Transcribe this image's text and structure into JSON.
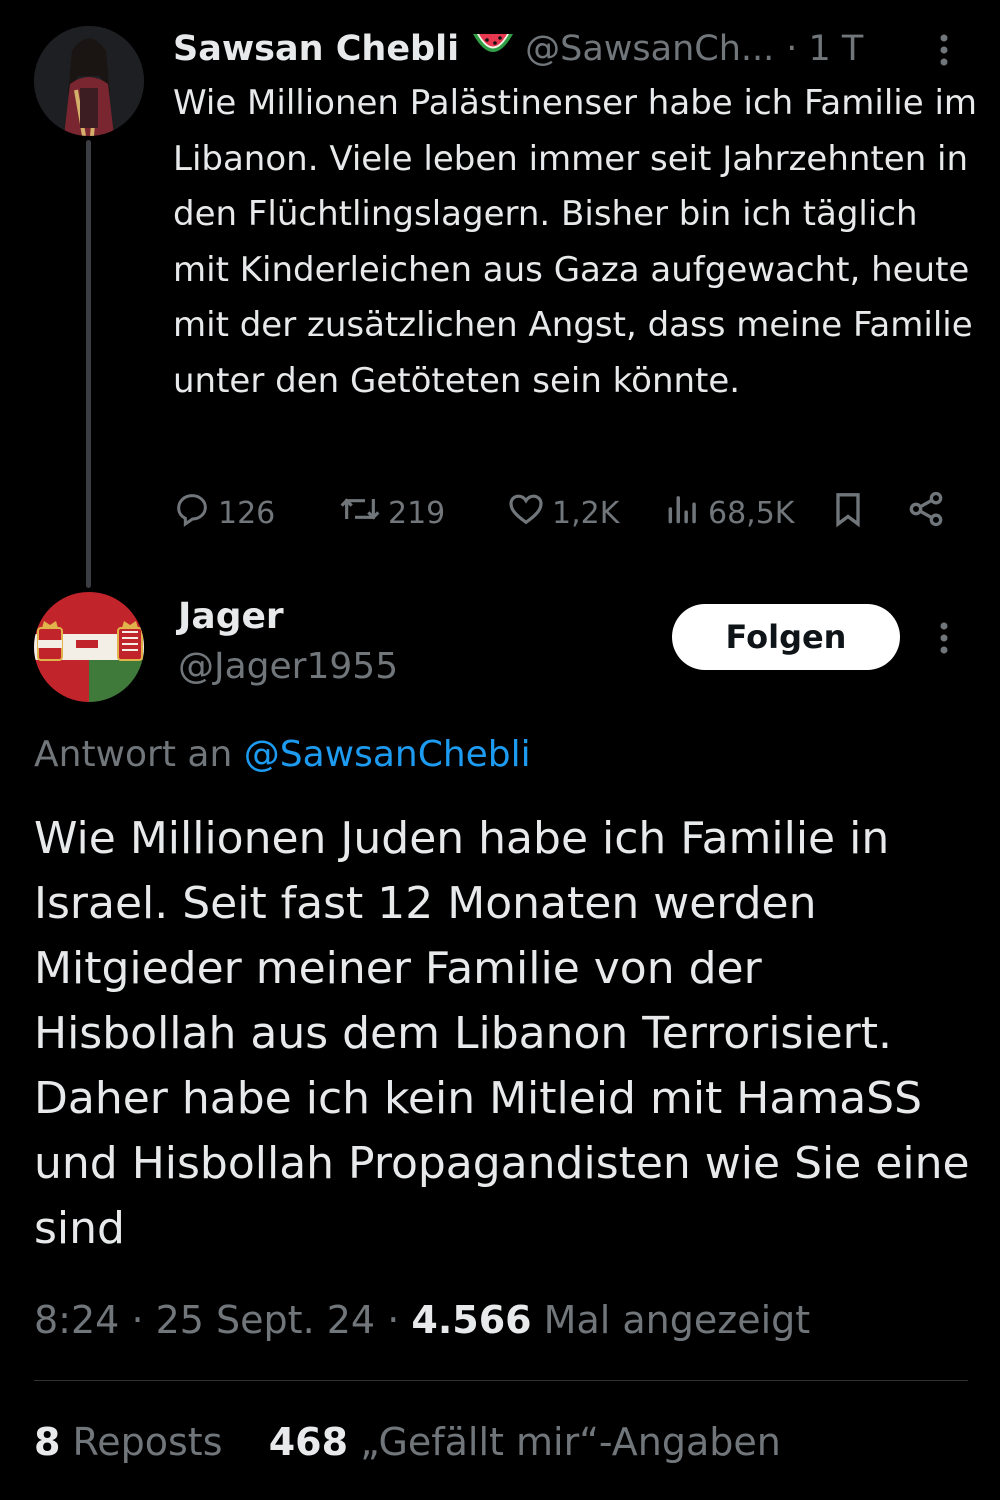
{
  "parent_tweet": {
    "author_name": "Sawsan Chebli",
    "author_handle": "@SawsanCh...",
    "time_ago": "· 1 T",
    "badge_icon": "watermelon-icon",
    "text": "Wie Millionen Palästinenser habe ich Familie im Libanon. Viele leben immer seit Jahrzehnten in den Flüchtlingslagern. Bisher bin ich täglich mit Kinderleichen aus Gaza aufgewacht, heute mit der zusätzlichen Angst, dass meine Familie unter den Getöteten sein könnte.",
    "actions": {
      "replies": "126",
      "reposts": "219",
      "likes": "1,2K",
      "views": "68,5K"
    }
  },
  "reply_tweet": {
    "author_name": "Jager",
    "author_handle": "@Jager1955",
    "follow_label": "Folgen",
    "replying_prefix": "Antwort an",
    "replying_to": "@SawsanChebli",
    "text": "Wie Millionen Juden habe ich Familie in Israel. Seit fast 12 Monaten werden Mitgieder meiner Familie von der Hisbollah aus dem Libanon Terrorisiert. Daher habe ich kein Mitleid mit HamaSS und Hisbollah Propagandisten wie Sie eine sind",
    "time": "8:24",
    "date": "25 Sept. 24",
    "views_count": "4.566",
    "views_label": "Mal angezeigt",
    "reposts_count": "8",
    "reposts_label": "Reposts",
    "likes_count": "468",
    "likes_label": "„Gefällt mir“-Angaben"
  },
  "colors": {
    "background": "#000000",
    "text": "#e7e9ea",
    "muted": "#71767b",
    "link": "#1d9bf0"
  }
}
